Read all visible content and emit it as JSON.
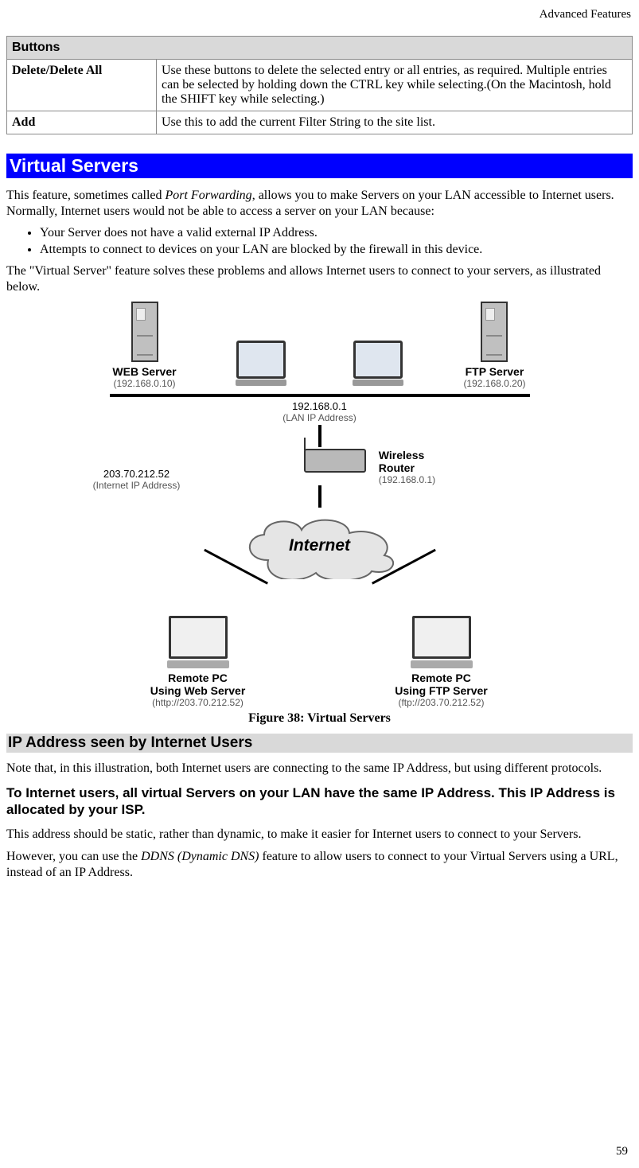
{
  "header": {
    "right": "Advanced Features"
  },
  "table": {
    "section": "Buttons",
    "rows": [
      {
        "label": "Delete/Delete All",
        "desc": "Use these buttons to delete the selected entry or all entries, as required. Multiple entries can be selected by holding down the CTRL key while selecting.(On the Macintosh, hold the SHIFT key while selecting.)"
      },
      {
        "label": "Add",
        "desc": "Use this to add the current Filter String to the site list."
      }
    ]
  },
  "section1": {
    "title": "Virtual Servers",
    "intro_a": "This feature, sometimes called ",
    "intro_em": "Port Forwarding",
    "intro_b": ", allows you to make Servers on your LAN accessible to Internet users. Normally, Internet users would not be able to access a server on your LAN because:",
    "bullets": [
      "Your Server does not have a valid external IP Address.",
      "Attempts to connect to devices on your LAN are blocked by the firewall in this device."
    ],
    "after_bullets": "The \"Virtual Server\" feature solves these problems and allows Internet users to connect to your servers, as illustrated below."
  },
  "figure": {
    "caption": "Figure 38: Virtual Servers",
    "web_server_label": "WEB Server",
    "web_server_ip": "(192.168.0.10)",
    "lan_ip_a": "192.168.0.1",
    "lan_ip_b": "(LAN IP Address)",
    "ftp_server_label": "FTP Server",
    "ftp_server_ip": "(192.168.0.20)",
    "router_label_a": "Wireless",
    "router_label_b": "Router",
    "router_ip": "(192.168.0.1)",
    "ext_ip_a": "203.70.212.52",
    "ext_ip_b": "(Internet IP Address)",
    "internet": "Internet",
    "remote_web_a": "Remote PC",
    "remote_web_b": "Using Web Server",
    "remote_web_c": "(http://203.70.212.52)",
    "remote_ftp_a": "Remote PC",
    "remote_ftp_b": "Using FTP Server",
    "remote_ftp_c": "(ftp://203.70.212.52)"
  },
  "section2": {
    "title": "IP Address seen by Internet Users",
    "p1": "Note that, in this illustration, both Internet users are connecting to the same IP Address, but using different protocols.",
    "bold": "To Internet users, all virtual Servers on your LAN have the same IP Address. This IP Address is allocated by your ISP.",
    "p2": "This address should be static, rather than dynamic, to make it easier for Internet users to connect to your Servers.",
    "p3_a": "However, you can use the ",
    "p3_em": "DDNS (Dynamic DNS)",
    "p3_b": " feature to allow users to connect to your Virtual Servers using a URL, instead of an IP Address."
  },
  "page_number": "59"
}
